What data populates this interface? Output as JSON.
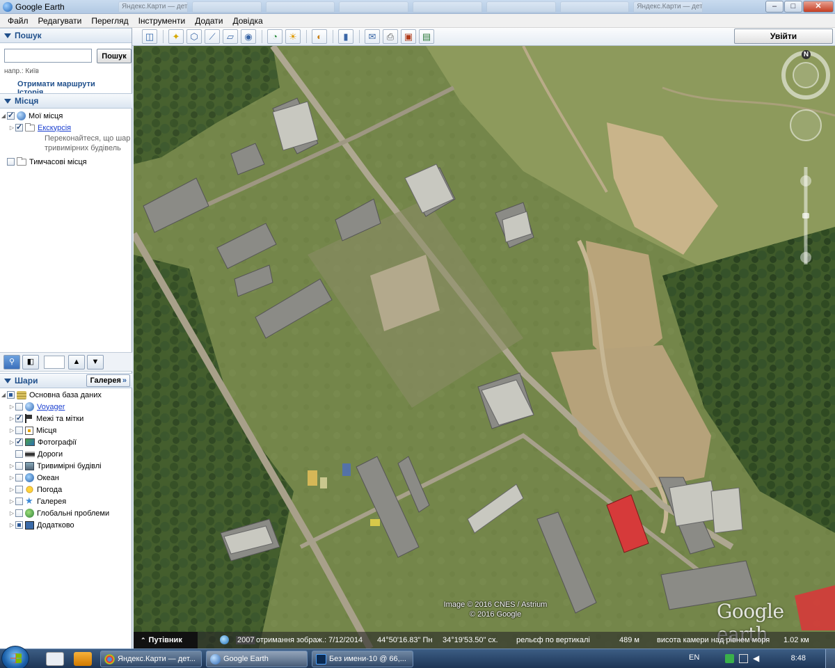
{
  "window": {
    "title": "Google Earth",
    "background_tabs": [
      "Яндекс.Карти — детальна карта",
      "",
      "",
      "",
      "",
      "",
      "",
      "Яндекс.Карти — дет..."
    ]
  },
  "menu": [
    "Файл",
    "Редагувати",
    "Перегляд",
    "Інструменти",
    "Додати",
    "Довідка"
  ],
  "search": {
    "header": "Пошук",
    "input_value": "",
    "button_label": "Пошук",
    "hint": "напр.: Київ",
    "link_directions": "Отримати маршрути",
    "link_history": "Історія"
  },
  "places": {
    "header": "Місця",
    "my_places": "Мої місця",
    "tour": "Екскурсія",
    "tour_note_line1": "Переконайтеся, що шар",
    "tour_note_line2": "тривимірних будівель",
    "temporary": "Тимчасові місця"
  },
  "layers": {
    "header": "Шари",
    "gallery_button": "Галерея",
    "gallery_chevron": "»",
    "items": [
      {
        "label": "Основна база даних",
        "icon": "layers-icon",
        "checked": "partial"
      },
      {
        "label": "Voyager",
        "icon": "globe-icon",
        "checked": "none",
        "link": true
      },
      {
        "label": "Межі та мітки",
        "icon": "flag-icon",
        "checked": "checked"
      },
      {
        "label": "Місця",
        "icon": "places-icon",
        "checked": "none"
      },
      {
        "label": "Фотографії",
        "icon": "photo-icon",
        "checked": "checked"
      },
      {
        "label": "Дороги",
        "icon": "road-icon",
        "checked": "none"
      },
      {
        "label": "Тривимірні будівлі",
        "icon": "building-icon",
        "checked": "none"
      },
      {
        "label": "Океан",
        "icon": "ocean-icon",
        "checked": "none"
      },
      {
        "label": "Погода",
        "icon": "sun-icon",
        "checked": "none"
      },
      {
        "label": "Галерея",
        "icon": "star-icon",
        "checked": "none"
      },
      {
        "label": "Глобальні проблеми",
        "icon": "world-icon",
        "checked": "none"
      },
      {
        "label": "Додатково",
        "icon": "extra-icon",
        "checked": "partial"
      }
    ]
  },
  "toolbar": {
    "sign_in": "Увійти"
  },
  "map": {
    "copyright_line1": "Image © 2016 CNES / Astrium",
    "copyright_line2": "© 2016 Google",
    "logo": "Google earth",
    "compass_north": "N"
  },
  "status": {
    "tour_guide": "Путівник",
    "imagery_year": "2007",
    "imagery_date": "отримання зображ.: 7/12/2014",
    "lat": "44°50'16.83\" Пн",
    "lon": "34°19'53.50\" сх.",
    "elev_label": "рельєф по вертикалі",
    "elev_value": "489 м",
    "eye_label": "висота камери над рівнем моря",
    "eye_value": "1.02 км"
  },
  "taskbar": {
    "tasks": [
      "Яндекс.Карти — дет...",
      "Google Earth",
      "Без имени-10 @ 66,..."
    ],
    "lang": "EN",
    "clock": "8:48"
  },
  "colors": {
    "header_blue": "#1f4f8b",
    "link_blue": "#1a3fd0",
    "map_green": "#7c8c4e",
    "roof_red": "#d63a3a"
  }
}
